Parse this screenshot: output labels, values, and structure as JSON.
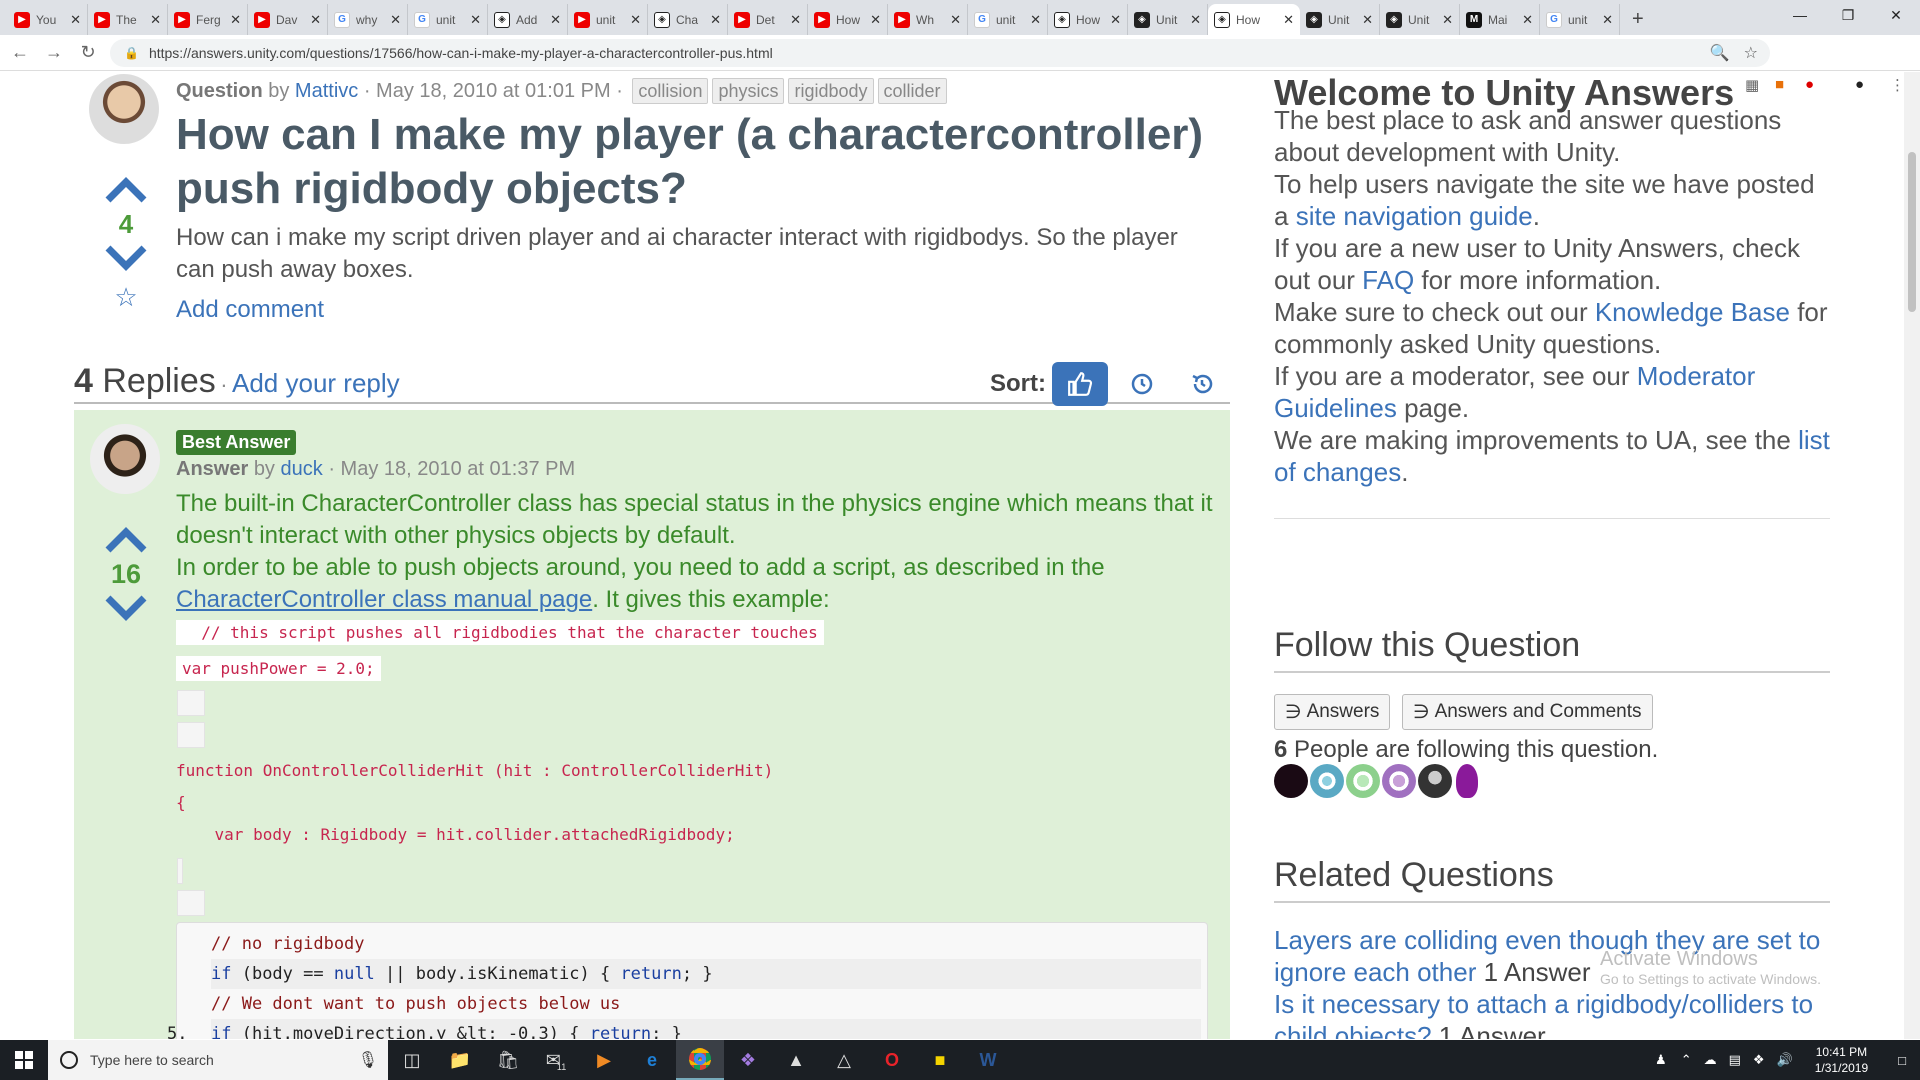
{
  "browser": {
    "tabs": [
      {
        "title": "You",
        "icon": "youtube-icon",
        "fav": "yt"
      },
      {
        "title": "The",
        "icon": "youtube-icon",
        "fav": "yt"
      },
      {
        "title": "Ferg",
        "icon": "youtube-icon",
        "fav": "yt"
      },
      {
        "title": "Dav",
        "icon": "youtube-icon",
        "fav": "yt"
      },
      {
        "title": "why",
        "icon": "google-icon",
        "fav": "g"
      },
      {
        "title": "unit",
        "icon": "google-icon",
        "fav": "g"
      },
      {
        "title": "Add",
        "icon": "unity-icon",
        "fav": "uo"
      },
      {
        "title": "unit",
        "icon": "youtube-icon",
        "fav": "yt"
      },
      {
        "title": "Cha",
        "icon": "unity-icon",
        "fav": "uo"
      },
      {
        "title": "Det",
        "icon": "youtube-icon",
        "fav": "yt"
      },
      {
        "title": "How",
        "icon": "youtube-icon",
        "fav": "yt"
      },
      {
        "title": "Wh",
        "icon": "youtube-icon",
        "fav": "yt"
      },
      {
        "title": "unit",
        "icon": "google-icon",
        "fav": "g"
      },
      {
        "title": "How",
        "icon": "unity-icon",
        "fav": "uo"
      },
      {
        "title": "Unit",
        "icon": "unity-icon",
        "fav": "u"
      },
      {
        "title": "How",
        "icon": "unity-icon",
        "fav": "uo",
        "active": true
      },
      {
        "title": "Unit",
        "icon": "unity-icon",
        "fav": "u"
      },
      {
        "title": "Unit",
        "icon": "unity-icon",
        "fav": "u"
      },
      {
        "title": "Mai",
        "icon": "medium-icon",
        "fav": "m"
      },
      {
        "title": "unit",
        "icon": "google-icon",
        "fav": "g"
      }
    ],
    "url": "https://answers.unity.com/questions/17566/how-can-i-make-my-player-a-charactercontroller-pus.html"
  },
  "question": {
    "type_label": "Question",
    "by": "by",
    "author": "Mattivc",
    "date": "· May 18, 2010 at 01:01 PM ·",
    "tags": [
      "collision",
      "physics",
      "rigidbody",
      "collider"
    ],
    "title": "How can I make my player (a charactercontroller) push rigidbody objects?",
    "body": "How can i make my script driven player and ai character interact with rigidbodys. So the player can push away boxes.",
    "votes": "4",
    "add_comment": "Add comment"
  },
  "replies": {
    "count": "4",
    "label": "Replies",
    "separator": "·",
    "add_reply": "Add your reply",
    "sort_label": "Sort:"
  },
  "answer": {
    "badge": "Best Answer",
    "type_label": "Answer",
    "by": "by",
    "author": "duck",
    "date": "· May 18, 2010 at 01:37 PM",
    "votes": "16",
    "p1": "The built-in CharacterController class has special status in the physics engine which means that it doesn't interact with other physics objects by default.",
    "p2a": "In order to be able to push objects around, you need to add a script, as described in the",
    "p2link": "CharacterController class manual page",
    "p2b": ". It gives this example:",
    "code_inline": [
      "  // this script pushes all rigidbodies that the character touches",
      "var pushPower = 2.0;",
      "function OnControllerColliderHit (hit : ControllerColliderHit)",
      "{",
      "    var body : Rigidbody = hit.collider.attachedRigidbody;"
    ],
    "code_block": {
      "l1": "// no rigidbody",
      "l2a": "if",
      "l2b": " (body == ",
      "l2c": "null",
      "l2d": " || body.isKinematic) { ",
      "l2e": "return",
      "l2f": "; }",
      "l3": "// We dont want to push objects below us",
      "l4num": "5.",
      "l4a": "if",
      "l4b": " (hit.moveDirection.y &lt; -0.3) { ",
      "l4c": "return",
      "l4d": "; }"
    }
  },
  "sidebar": {
    "welcome_title": "Welcome to Unity Answers",
    "w1": "The best place to ask and answer questions about development with Unity.",
    "w2a": "To help users navigate the site we have posted a ",
    "w2link": "site navigation guide",
    "w2b": ".",
    "w3a": "If you are a new user to Unity Answers, check out our ",
    "w3link": "FAQ",
    "w3b": " for more information.",
    "w4a": "Make sure to check out our ",
    "w4link": "Knowledge Base",
    "w4b": " for commonly asked Unity questions.",
    "w5a": "If you are a moderator, see our ",
    "w5link": "Moderator Guidelines",
    "w5b": " page.",
    "w6a": "We are making improvements to UA, see the ",
    "w6link": "list of changes",
    "w6b": ".",
    "follow_title": "Follow this Question",
    "follow_answers": "Answers",
    "follow_all": "Answers and Comments",
    "follow_count": "6",
    "follow_text": " People are following this question.",
    "related_title": "Related Questions",
    "r1": "Layers are colliding even though they are set to ignore each other",
    "r1count": " 1 Answer",
    "r2": "Is it necessary to attach a rigidbody/colliders to child objects?",
    "r2count": " 1 Answer",
    "activate1": "Activate Windows",
    "activate2": "Go to Settings to activate Windows."
  },
  "taskbar": {
    "search_placeholder": "Type here to search",
    "time": "10:41 PM",
    "date": "1/31/2019",
    "mail_badge": "11"
  },
  "colors": {
    "link": "#3b73b9",
    "answer_bg": "#dff0d8",
    "answer_text": "#3a8a2a",
    "badge": "#3a7d2e",
    "title": "#4a5a66"
  }
}
